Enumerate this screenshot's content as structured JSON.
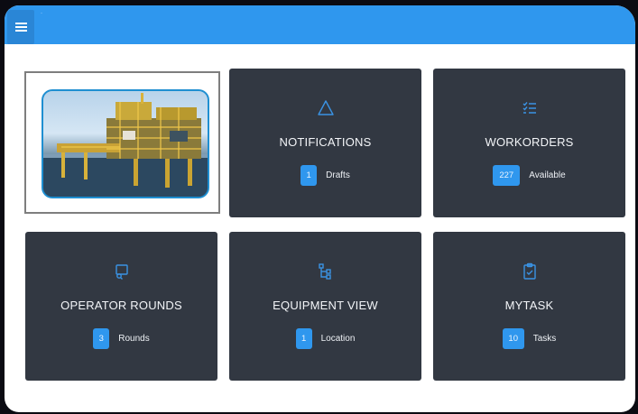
{
  "appbar": {
    "menu_icon": "hamburger-menu-icon",
    "title": "·"
  },
  "hero": {
    "image_alt": "Offshore oil platform"
  },
  "tiles": [
    {
      "key": "notifications",
      "title": "NOTIFICATIONS",
      "count": "1",
      "label": "Drafts",
      "icon": "warning-triangle-icon"
    },
    {
      "key": "workorders",
      "title": "WORKORDERS",
      "count": "227",
      "label": "Available",
      "icon": "checklist-icon"
    },
    {
      "key": "operator-rounds",
      "title": "OPERATOR ROUNDS",
      "count": "3",
      "label": "Rounds",
      "icon": "rounds-icon"
    },
    {
      "key": "equipment-view",
      "title": "EQUIPMENT VIEW",
      "count": "1",
      "label": "Location",
      "icon": "hierarchy-icon"
    },
    {
      "key": "mytask",
      "title": "MYTASK",
      "count": "10",
      "label": "Tasks",
      "icon": "clipboard-icon"
    }
  ],
  "colors": {
    "accent": "#2f97ee",
    "tile_bg": "#323842",
    "icon": "#3a93e4"
  }
}
